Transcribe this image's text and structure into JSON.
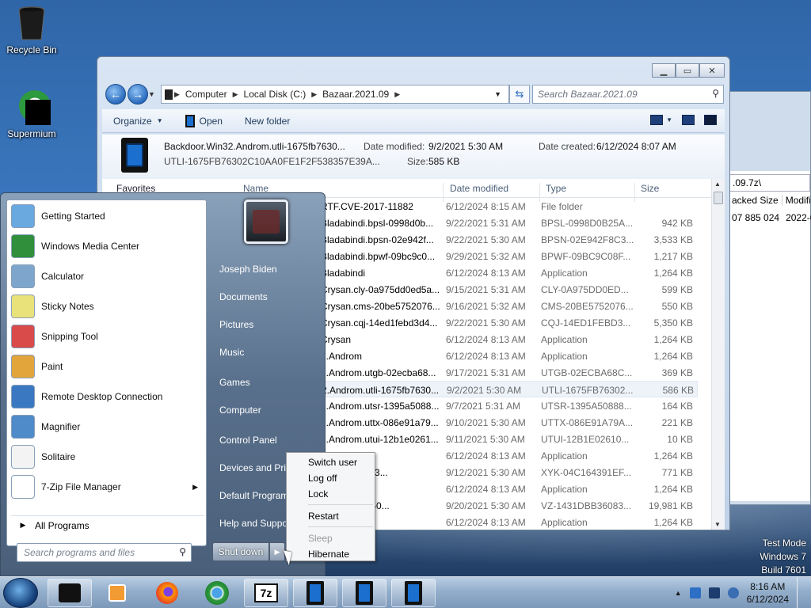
{
  "desktop": {
    "icons": [
      {
        "label": "Recycle Bin",
        "icon": "recycle-bin-icon"
      },
      {
        "label": "Supermium",
        "icon": "supermium-icon"
      }
    ],
    "watermark": [
      "Test Mode",
      "Windows 7",
      "Build 7601"
    ]
  },
  "back_window": {
    "path": ".09.7z\\",
    "headers": [
      "acked Size",
      "Modifie"
    ],
    "row": [
      "07 885 024",
      "2022-03"
    ]
  },
  "explorer": {
    "address": [
      "Computer",
      "Local Disk (C:)",
      "Bazaar.2021.09"
    ],
    "search_placeholder": "Search Bazaar.2021.09",
    "toolbar": {
      "organize": "Organize",
      "open": "Open",
      "new_folder": "New folder"
    },
    "details": {
      "name": "Backdoor.Win32.Androm.utli-1675fb7630...",
      "name2": "UTLI-1675FB76302C10AA0FE1F2F538357E39A...",
      "date_modified_label": "Date modified:",
      "date_modified": "9/2/2021 5:30 AM",
      "date_created_label": "Date created:",
      "date_created": "6/12/2024 8:07 AM",
      "size_label": "Size:",
      "size": "585 KB"
    },
    "nav_favorites": "Favorites",
    "columns": {
      "name": "Name",
      "date": "Date modified",
      "type": "Type",
      "size": "Size"
    },
    "rows": [
      {
        "name": "RTF.CVE-2017-11882",
        "date": "6/12/2024 8:15 AM",
        "type": "File folder",
        "size": ""
      },
      {
        "name": "Bladabindi.bpsl-0998d0b...",
        "date": "9/22/2021 5:31 AM",
        "type": "BPSL-0998D0B25A...",
        "size": "942 KB"
      },
      {
        "name": "Bladabindi.bpsn-02e942f...",
        "date": "9/22/2021 5:30 AM",
        "type": "BPSN-02E942F8C3...",
        "size": "3,533 KB"
      },
      {
        "name": "Bladabindi.bpwf-09bc9c0...",
        "date": "9/29/2021 5:32 AM",
        "type": "BPWF-09BC9C08F...",
        "size": "1,217 KB"
      },
      {
        "name": "Bladabindi",
        "date": "6/12/2024 8:13 AM",
        "type": "Application",
        "size": "1,264 KB"
      },
      {
        "name": "Crysan.cly-0a975dd0ed5a...",
        "date": "9/15/2021 5:31 AM",
        "type": "CLY-0A975DD0ED...",
        "size": "599 KB"
      },
      {
        "name": "Crysan.cms-20be5752076...",
        "date": "9/16/2021 5:32 AM",
        "type": "CMS-20BE5752076...",
        "size": "550 KB"
      },
      {
        "name": "Crysan.cqj-14ed1febd3d4...",
        "date": "9/22/2021 5:30 AM",
        "type": "CQJ-14ED1FEBD3...",
        "size": "5,350 KB"
      },
      {
        "name": "Crysan",
        "date": "6/12/2024 8:13 AM",
        "type": "Application",
        "size": "1,264 KB"
      },
      {
        "name": "2.Androm",
        "date": "6/12/2024 8:13 AM",
        "type": "Application",
        "size": "1,264 KB"
      },
      {
        "name": "2.Androm.utgb-02ecba68...",
        "date": "9/17/2021 5:31 AM",
        "type": "UTGB-02ECBA68C...",
        "size": "369 KB"
      },
      {
        "name": "2.Androm.utli-1675fb7630...",
        "date": "9/2/2021 5:30 AM",
        "type": "UTLI-1675FB76302...",
        "size": "586 KB"
      },
      {
        "name": "2.Androm.utsr-1395a5088...",
        "date": "9/7/2021 5:31 AM",
        "type": "UTSR-1395A50888...",
        "size": "164 KB"
      },
      {
        "name": "2.Androm.uttx-086e91a79...",
        "date": "9/10/2021 5:30 AM",
        "type": "UTTX-086E91A79A...",
        "size": "221 KB"
      },
      {
        "name": "2.Androm.utui-12b1e0261...",
        "date": "9/11/2021 5:30 AM",
        "type": "UTUI-12B1E02610...",
        "size": "10 KB"
      },
      {
        "name": "t",
        "date": "6/12/2024 8:13 AM",
        "type": "Application",
        "size": "1,264 KB"
      },
      {
        "name": "t.xyk-04c1643...",
        "date": "9/12/2021 5:30 AM",
        "type": "XYK-04C164391EF...",
        "size": "771 KB"
      },
      {
        "name": "",
        "date": "6/12/2024 8:13 AM",
        "type": "Application",
        "size": "1,264 KB"
      },
      {
        "name": "z-1431dbb360...",
        "date": "9/20/2021 5:30 AM",
        "type": "VZ-1431DBB36083...",
        "size": "19,981 KB"
      },
      {
        "name": "",
        "date": "6/12/2024 8:13 AM",
        "type": "Application",
        "size": "1,264 KB"
      }
    ],
    "selected_row": 11
  },
  "start_menu": {
    "programs": [
      {
        "label": "Getting Started",
        "icon": "getting-started-icon",
        "color": "#6aa8e0"
      },
      {
        "label": "Windows Media Center",
        "icon": "windows-media-center-icon",
        "color": "#2f8f3a"
      },
      {
        "label": "Calculator",
        "icon": "calculator-icon",
        "color": "#7ea6cc"
      },
      {
        "label": "Sticky Notes",
        "icon": "sticky-notes-icon",
        "color": "#e9e27a"
      },
      {
        "label": "Snipping Tool",
        "icon": "snipping-tool-icon",
        "color": "#d94a4a"
      },
      {
        "label": "Paint",
        "icon": "paint-icon",
        "color": "#e2a53c"
      },
      {
        "label": "Remote Desktop Connection",
        "icon": "remote-desktop-icon",
        "color": "#3b78c2"
      },
      {
        "label": "Magnifier",
        "icon": "magnifier-icon",
        "color": "#4f8ac9"
      },
      {
        "label": "Solitaire",
        "icon": "solitaire-icon",
        "color": "#f3f3f3"
      },
      {
        "label": "7-Zip File Manager",
        "icon": "7zip-icon",
        "color": "#ffffff",
        "submenu": true
      }
    ],
    "all_programs": "All Programs",
    "search_placeholder": "Search programs and files",
    "right_items": [
      "Joseph Biden",
      "Documents",
      "Pictures",
      "Music",
      "Games",
      "Computer",
      "Control Panel",
      "Devices and Printers",
      "Default Programs",
      "Help and Support"
    ],
    "shutdown": "Shut down"
  },
  "shutdown_menu": {
    "items": [
      "Switch user",
      "Log off",
      "Lock",
      "Restart",
      "Sleep",
      "Hibernate"
    ],
    "disabled": [
      "Sleep"
    ]
  },
  "taskbar": {
    "time": "8:16 AM",
    "date": "6/12/2024"
  }
}
